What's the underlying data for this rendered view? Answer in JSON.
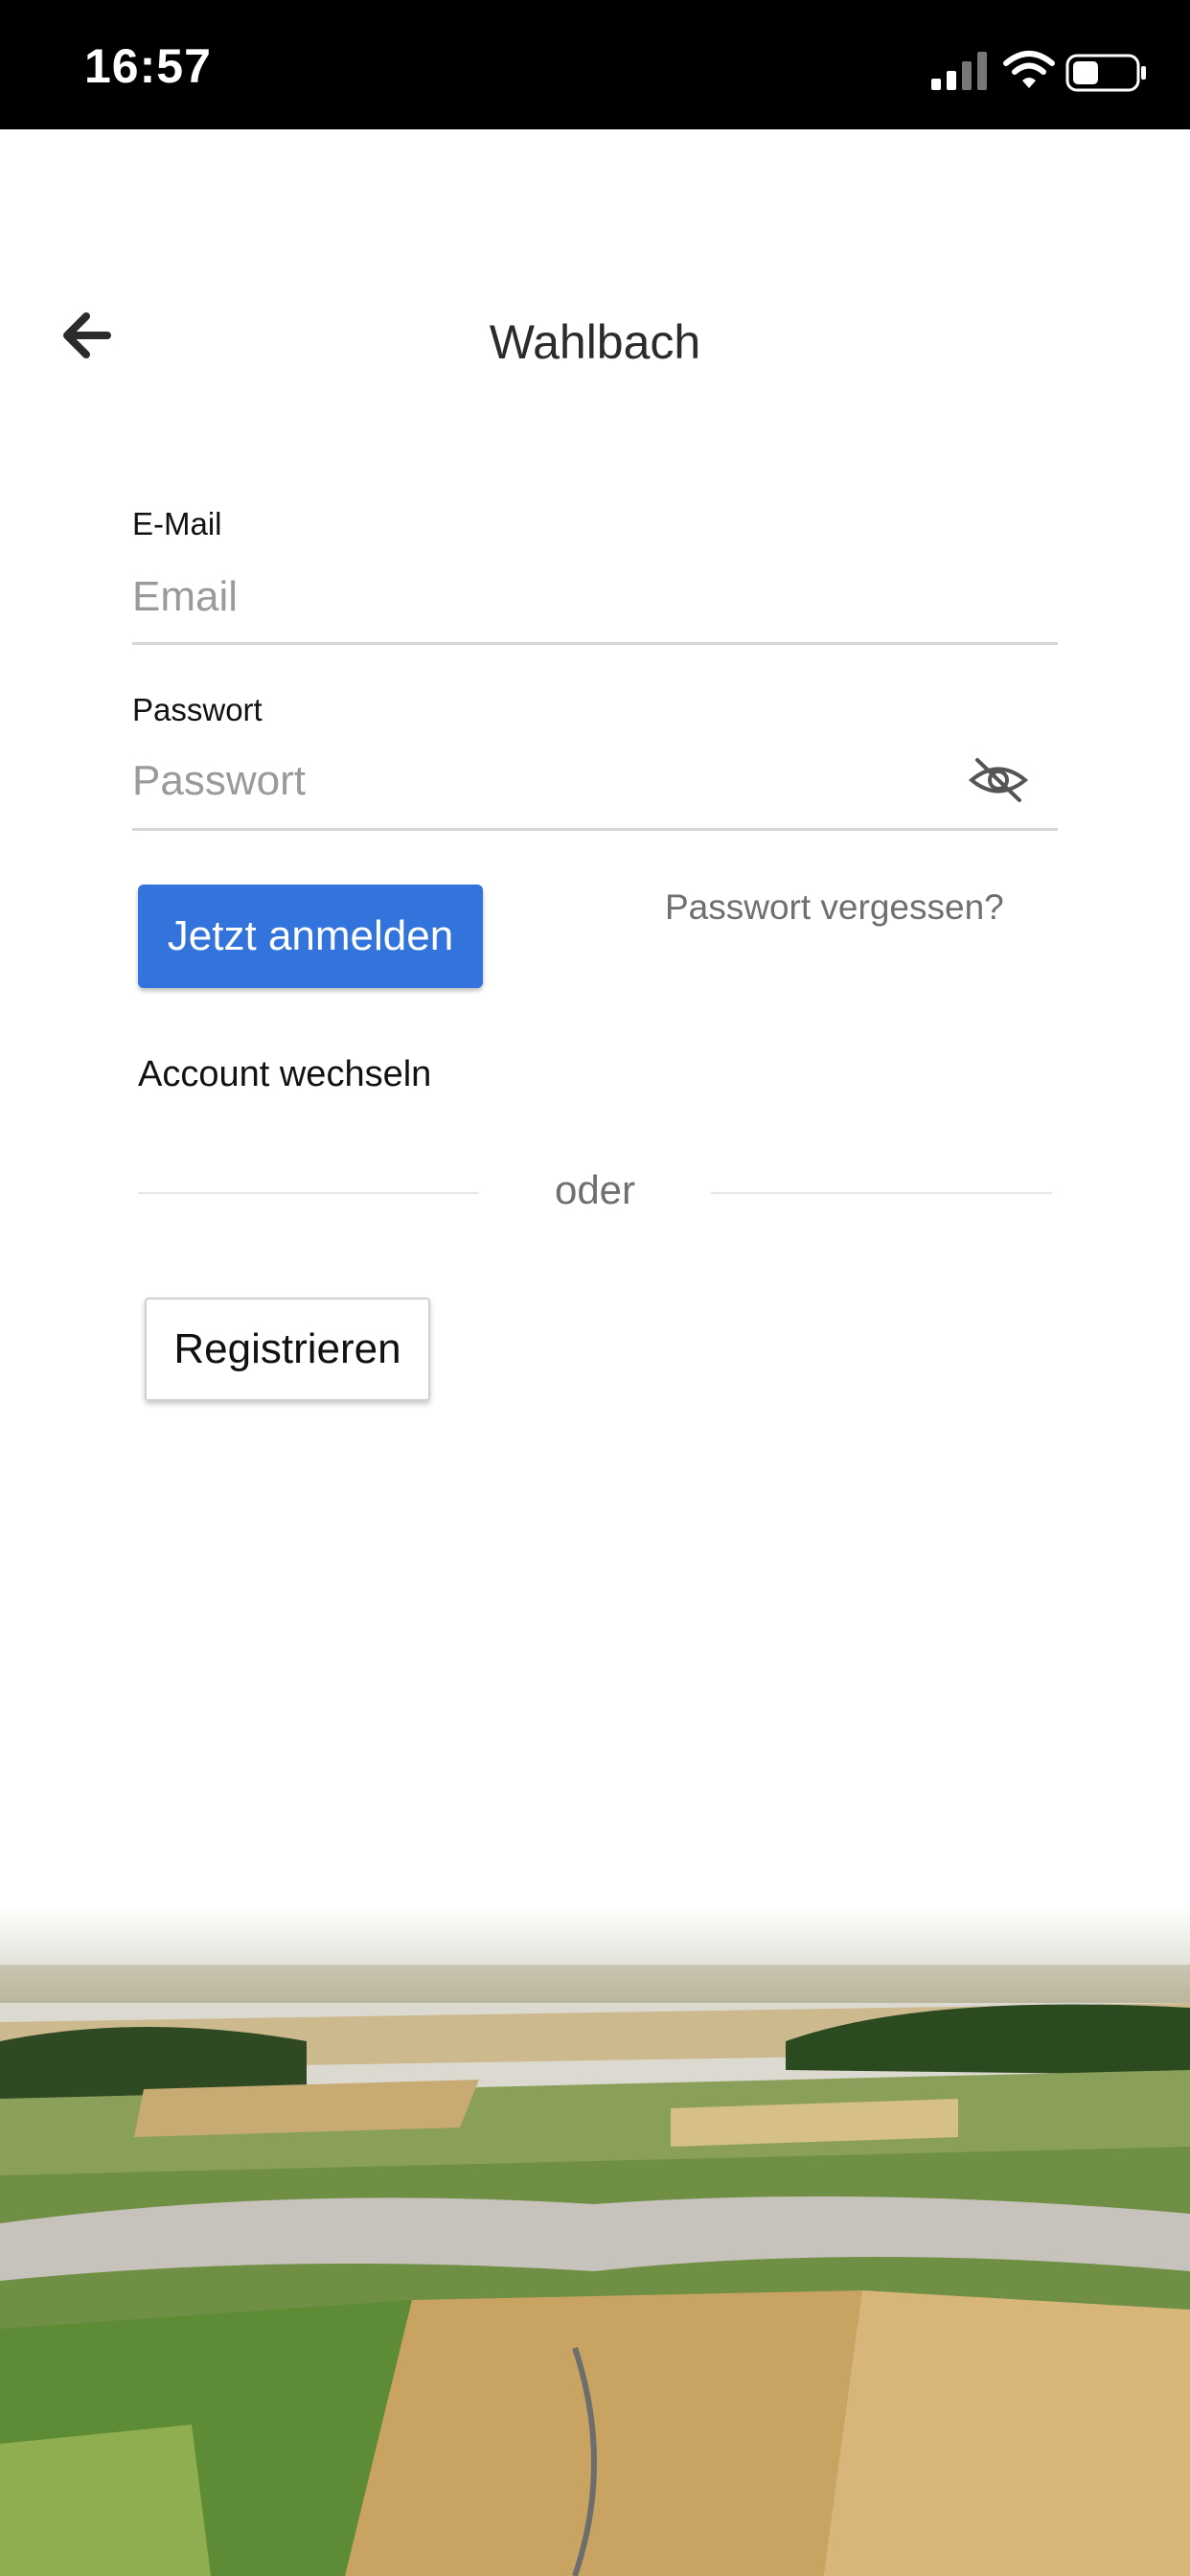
{
  "status_bar": {
    "time": "16:57",
    "icons": [
      "cellular-signal-icon",
      "wifi-icon",
      "battery-icon"
    ]
  },
  "header": {
    "back_icon": "arrow-left-icon",
    "title": "Wahlbach"
  },
  "form": {
    "email": {
      "label": "E-Mail",
      "placeholder": "Email",
      "value": ""
    },
    "password": {
      "label": "Passwort",
      "placeholder": "Passwort",
      "value": "",
      "toggle_icon": "eye-off-icon"
    },
    "login_button": "Jetzt anmelden",
    "forgot_link": "Passwort vergessen?",
    "switch_account": "Account wechseln",
    "divider": "oder",
    "register_button": "Registrieren"
  },
  "colors": {
    "primary": "#3273dc",
    "status_bar_bg": "#000000",
    "muted_text": "#6f6f6f"
  },
  "footer_image": "aerial-village-landscape"
}
